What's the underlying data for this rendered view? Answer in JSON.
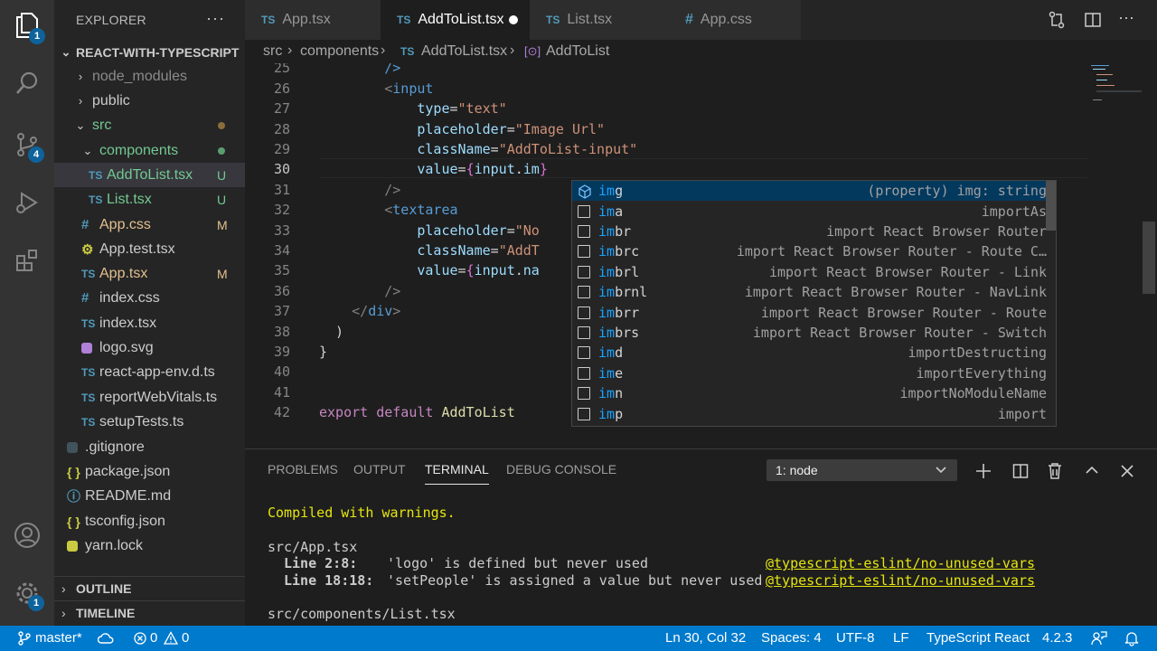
{
  "activity": {
    "explorer_badge": "1",
    "scm_badge": "4",
    "settings_badge": "1"
  },
  "sidebar": {
    "title": "EXPLORER",
    "more": "···",
    "project": "REACT-WITH-TYPESCRIPT",
    "items": [
      {
        "label": "node_modules",
        "icon": "",
        "status": "",
        "color": "#8b8b8b"
      },
      {
        "label": "public",
        "icon": "",
        "status": "",
        "color": "#cccccc"
      },
      {
        "label": "src",
        "icon": "",
        "status": "",
        "color": "#73c991"
      },
      {
        "label": "components",
        "icon": "",
        "status": "",
        "color": "#73c991"
      },
      {
        "label": "AddToList.tsx",
        "icon": "TS",
        "status": "U",
        "color": "#73c991"
      },
      {
        "label": "List.tsx",
        "icon": "TS",
        "status": "U",
        "color": "#73c991"
      },
      {
        "label": "App.css",
        "icon": "#",
        "status": "M",
        "color": "#e2c08d"
      },
      {
        "label": "App.test.tsx",
        "icon": "",
        "status": "",
        "color": "#cccccc"
      },
      {
        "label": "App.tsx",
        "icon": "TS",
        "status": "M",
        "color": "#e2c08d"
      },
      {
        "label": "index.css",
        "icon": "#",
        "status": "",
        "color": "#cccccc"
      },
      {
        "label": "index.tsx",
        "icon": "TS",
        "status": "",
        "color": "#cccccc"
      },
      {
        "label": "logo.svg",
        "icon": "",
        "status": "",
        "color": "#cccccc"
      },
      {
        "label": "react-app-env.d.ts",
        "icon": "TS",
        "status": "",
        "color": "#cccccc"
      },
      {
        "label": "reportWebVitals.ts",
        "icon": "TS",
        "status": "",
        "color": "#cccccc"
      },
      {
        "label": "setupTests.ts",
        "icon": "TS",
        "status": "",
        "color": "#cccccc"
      },
      {
        "label": ".gitignore",
        "icon": "",
        "status": "",
        "color": "#cccccc"
      },
      {
        "label": "package.json",
        "icon": "{ }",
        "status": "",
        "color": "#cccccc"
      },
      {
        "label": "README.md",
        "icon": "",
        "status": "",
        "color": "#cccccc"
      },
      {
        "label": "tsconfig.json",
        "icon": "{ }",
        "status": "",
        "color": "#cccccc"
      },
      {
        "label": "yarn.lock",
        "icon": "",
        "status": "",
        "color": "#cccccc"
      }
    ],
    "outline": "OUTLINE",
    "timeline": "TIMELINE"
  },
  "tabs": [
    {
      "icon": "TS",
      "label": "App.tsx"
    },
    {
      "icon": "TS",
      "label": "AddToList.tsx"
    },
    {
      "icon": "TS",
      "label": "List.tsx"
    },
    {
      "icon": "#",
      "label": "App.css"
    }
  ],
  "breadcrumb": {
    "p1": "src",
    "sep": "›",
    "p2": "components",
    "p3_icon": "TS",
    "p3": "AddToList.tsx",
    "p4": "AddToList"
  },
  "editor": {
    "line_numbers": [
      "25",
      "26",
      "27",
      "28",
      "29",
      "30",
      "31",
      "32",
      "33",
      "34",
      "35",
      "36",
      "37",
      "38",
      "39",
      "40",
      "41",
      "42"
    ]
  },
  "suggest": [
    {
      "match": "im",
      "rest": "g",
      "detail": "(property) img: string"
    },
    {
      "match": "im",
      "rest": "a",
      "detail": "importAs"
    },
    {
      "match": "im",
      "rest": "br",
      "detail": "import React Browser Router"
    },
    {
      "match": "im",
      "rest": "brc",
      "detail": "import React Browser Router - Route C…"
    },
    {
      "match": "im",
      "rest": "brl",
      "detail": "import React Browser Router - Link"
    },
    {
      "match": "im",
      "rest": "brnl",
      "detail": "import React Browser Router - NavLink"
    },
    {
      "match": "im",
      "rest": "brr",
      "detail": "import React Browser Router - Route"
    },
    {
      "match": "im",
      "rest": "brs",
      "detail": "import React Browser Router - Switch"
    },
    {
      "match": "im",
      "rest": "d",
      "detail": "importDestructing"
    },
    {
      "match": "im",
      "rest": "e",
      "detail": "importEverything"
    },
    {
      "match": "im",
      "rest": "n",
      "detail": "importNoModuleName"
    },
    {
      "match": "im",
      "rest": "p",
      "detail": "import"
    }
  ],
  "panel": {
    "tabs": [
      "PROBLEMS",
      "OUTPUT",
      "TERMINAL",
      "DEBUG CONSOLE"
    ],
    "terminal_select": "1: node",
    "compiled": "Compiled with warnings.",
    "file1": "src/App.tsx",
    "w1_loc": "Line 2:8:",
    "w1_msg": "'logo' is defined but never used",
    "w1_rule": "@typescript-eslint/no-unused-vars",
    "w2_loc": "Line 18:18:",
    "w2_msg": "'setPeople' is assigned a value but never used",
    "w2_rule": "@typescript-eslint/no-unused-vars",
    "file2": "src/components/List.tsx"
  },
  "status": {
    "branch": "master*",
    "errors": "0",
    "warnings": "0",
    "position": "Ln 30, Col 32",
    "spaces": "Spaces: 4",
    "encoding": "UTF-8",
    "eol": "LF",
    "language": "TypeScript React",
    "version": "4.2.3"
  }
}
